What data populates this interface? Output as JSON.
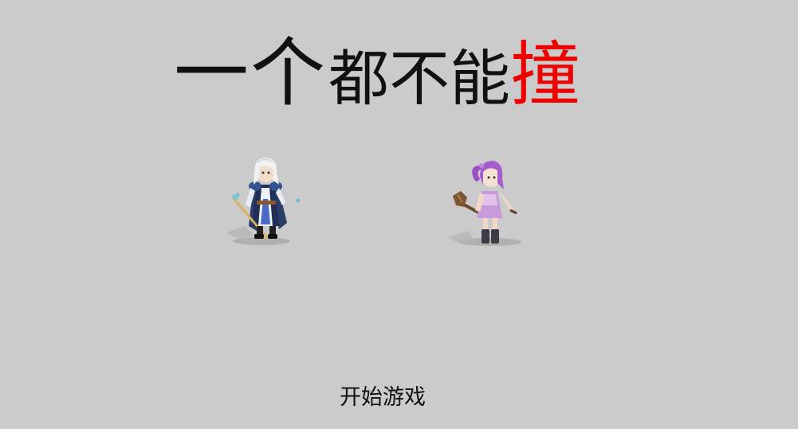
{
  "title": {
    "part1": "一个",
    "part2": "都不能",
    "accent": "撞",
    "accent_color": "#ee0000"
  },
  "characters": [
    {
      "name": "white-haired-swordsman-icon"
    },
    {
      "name": "purple-haired-mage-girl-icon"
    }
  ],
  "start_button": {
    "label": "开始游戏"
  },
  "colors": {
    "background": "#cbcbcb",
    "text": "#111111"
  }
}
